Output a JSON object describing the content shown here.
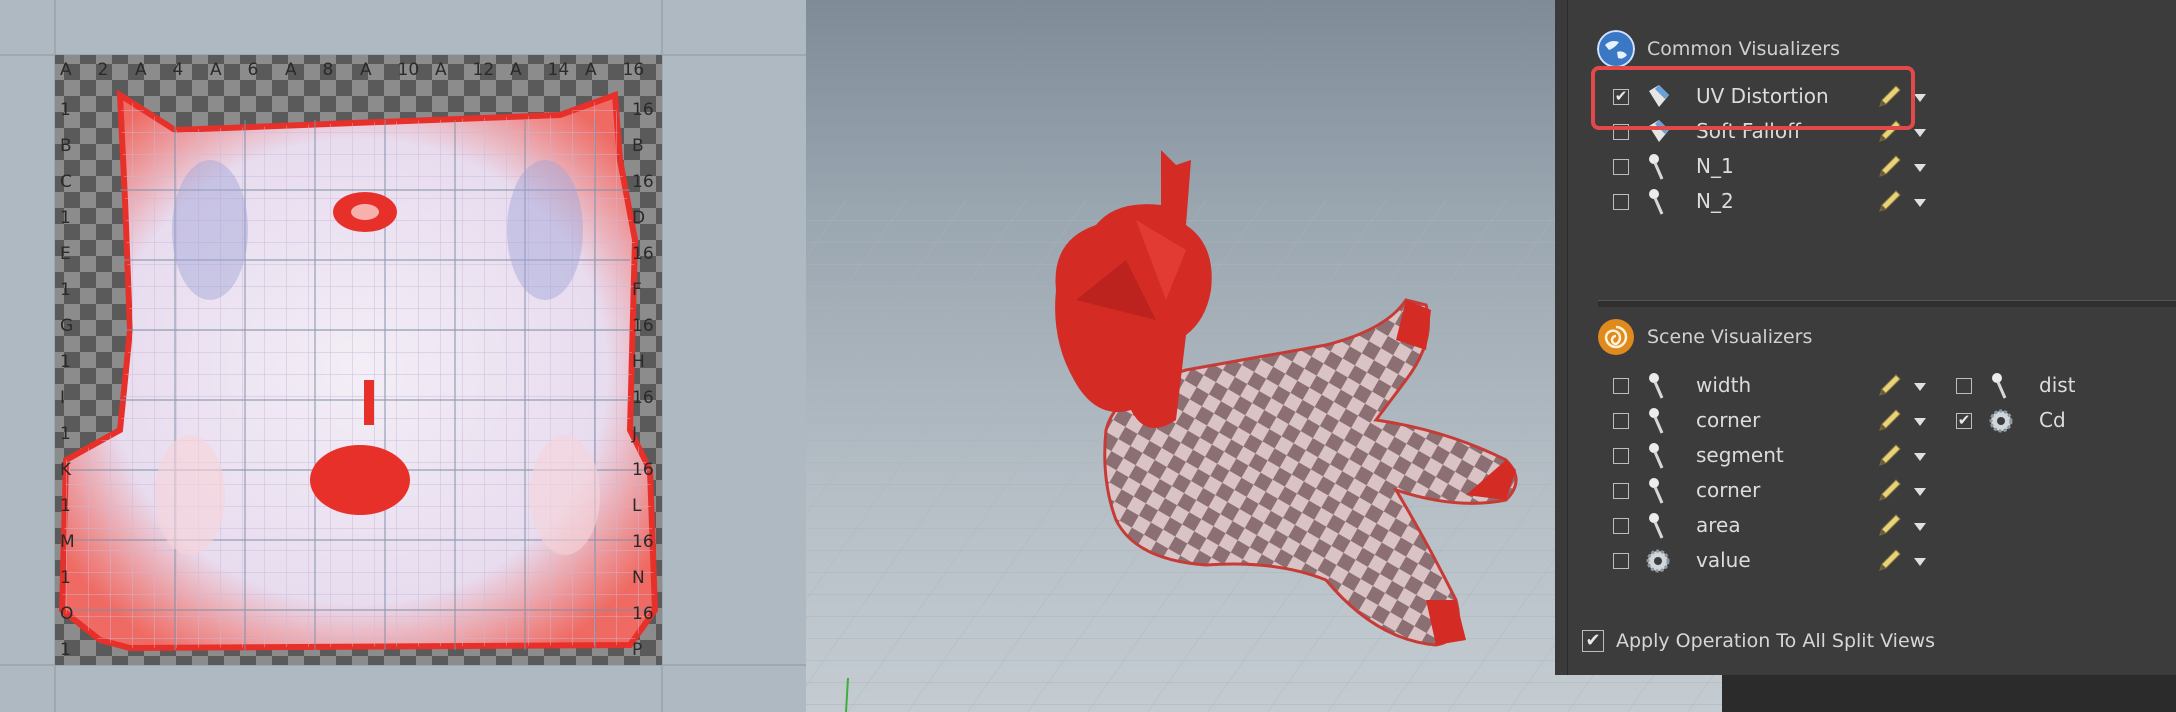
{
  "uv_view": {
    "grid_top_labels": [
      "A",
      "2",
      "A",
      "4",
      "A",
      "6",
      "A",
      "8",
      "A",
      "10",
      "A",
      "12",
      "A",
      "14",
      "A",
      "16"
    ],
    "grid_left_labels": [
      "1",
      "B",
      "C",
      "1",
      "E",
      "1",
      "G",
      "1",
      "I",
      "1",
      "K",
      "1",
      "M",
      "1",
      "O",
      "1"
    ],
    "grid_right_labels": [
      "16",
      "B",
      "16",
      "D",
      "16",
      "F",
      "16",
      "H",
      "16",
      "J",
      "16",
      "L",
      "16",
      "N",
      "16",
      "P"
    ]
  },
  "panel": {
    "common_section": {
      "title": "Common Visualizers",
      "items": [
        {
          "label": "UV Distortion",
          "checked": true,
          "icon": "uv-tag-icon"
        },
        {
          "label": "Soft Falloff",
          "checked": false,
          "icon": "uv-tag-icon"
        },
        {
          "label": "N_1",
          "checked": false,
          "icon": "marker-pin-icon"
        },
        {
          "label": "N_2",
          "checked": false,
          "icon": "marker-pin-icon"
        }
      ]
    },
    "scene_section": {
      "title": "Scene Visualizers",
      "items_left": [
        {
          "label": "width",
          "checked": false,
          "icon": "marker-pin-icon"
        },
        {
          "label": "corner",
          "checked": false,
          "icon": "marker-pin-icon"
        },
        {
          "label": "segment",
          "checked": false,
          "icon": "marker-pin-icon"
        },
        {
          "label": "corner",
          "checked": false,
          "icon": "marker-pin-icon"
        },
        {
          "label": "area",
          "checked": false,
          "icon": "marker-pin-icon"
        },
        {
          "label": "value",
          "checked": false,
          "icon": "gear-icon"
        }
      ],
      "items_right": [
        {
          "label": "dist",
          "checked": false,
          "icon": "marker-pin-icon"
        },
        {
          "label": "Cd",
          "checked": true,
          "icon": "gear-icon"
        }
      ]
    },
    "apply_all": {
      "label": "Apply Operation To All Split Views",
      "checked": true
    }
  },
  "colors": {
    "highlight": "#e24a4a",
    "panel_bg": "#3c3c3c",
    "distortion_red": "#e8302a"
  }
}
